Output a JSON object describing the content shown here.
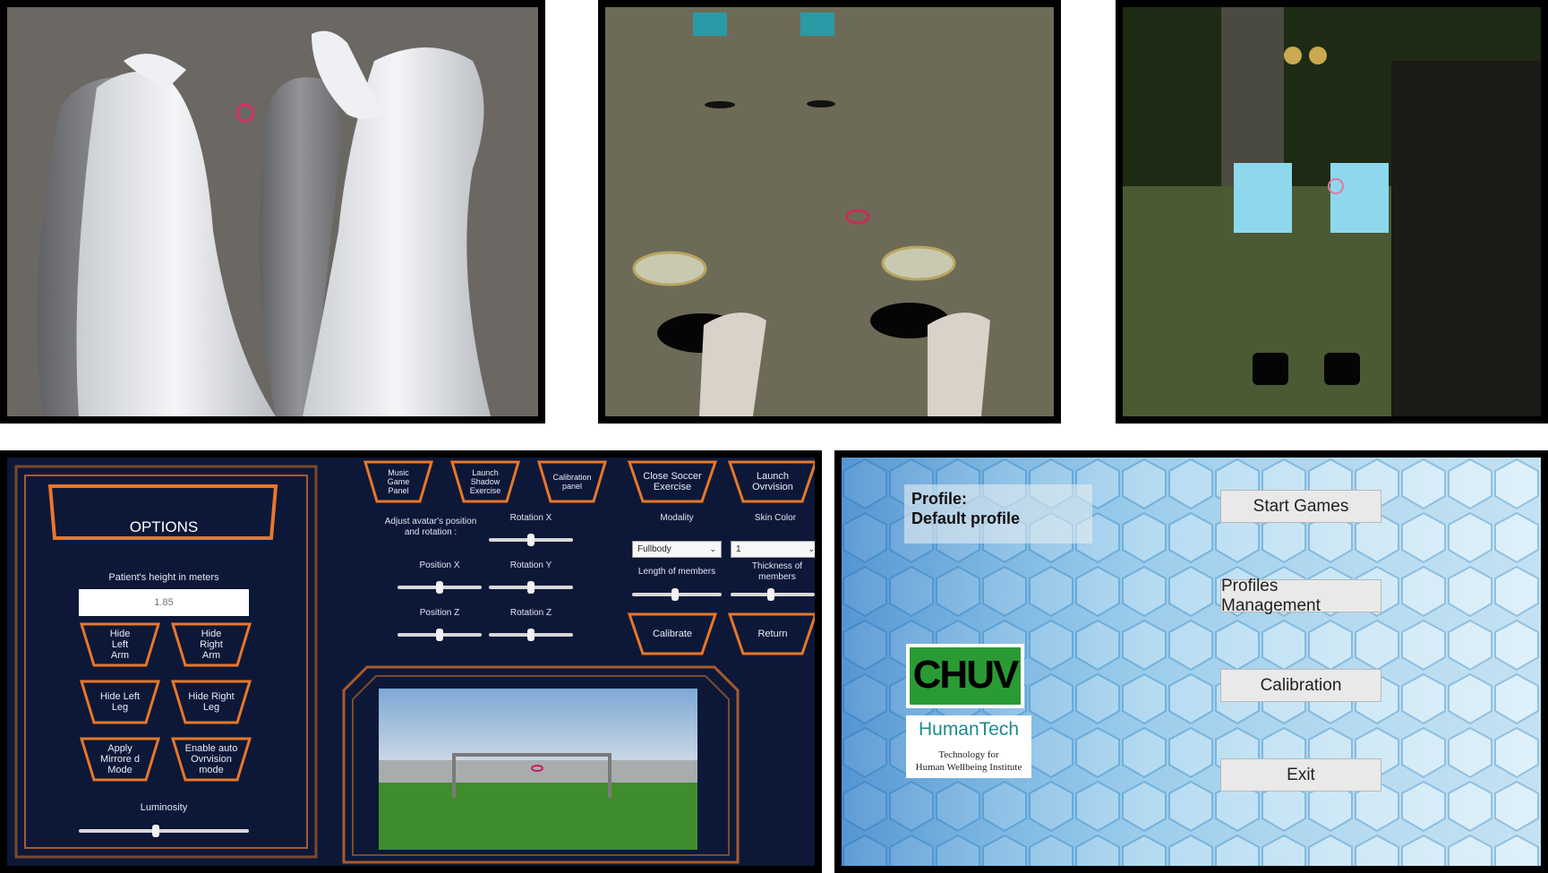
{
  "options_panel": {
    "title": "OPTIONS",
    "height_label": "Patient's height in meters",
    "height_placeholder": "1.85",
    "buttons": {
      "hide_left_arm": "Hide Left Arm",
      "hide_right_arm": "Hide Right Arm",
      "hide_left_leg": "Hide Left Leg",
      "hide_right_leg": "Hide Right Leg",
      "apply_mirrored": "Apply Mirrore d Mode",
      "enable_ovrvision": "Enable auto Ovrvision mode",
      "music_game": "Music Game Panel",
      "shadow_exercise": "Launch Shadow Exercise",
      "calibration_panel": "Calibration panel",
      "close_soccer": "Close Soccer Exercise",
      "launch_ovrvision": "Launch Ovrvision",
      "calibrate": "Calibrate",
      "return": "Return"
    },
    "luminosity_label": "Luminosity",
    "luminosity_value": 0.45,
    "adjust_label": "Adjust avatar's position and rotation :",
    "sliders": {
      "rotation_x": {
        "label": "Rotation X",
        "value": 0.5
      },
      "position_x": {
        "label": "Position X",
        "value": 0.5
      },
      "rotation_y": {
        "label": "Rotation Y",
        "value": 0.5
      },
      "position_z": {
        "label": "Position Z",
        "value": 0.5
      },
      "rotation_z": {
        "label": "Rotation Z",
        "value": 0.5
      },
      "length_members": {
        "label": "Length of members",
        "value": 0.48
      },
      "thickness_members": {
        "label": "Thickness of members",
        "value": 0.48
      }
    },
    "modality": {
      "label": "Modality",
      "selected": "Fullbody"
    },
    "skin_color": {
      "label": "Skin Color",
      "selected": "1"
    }
  },
  "main_menu": {
    "profile_title": "Profile:",
    "profile_name": "Default profile",
    "buttons": {
      "start_games": "Start Games",
      "profiles_management": "Profiles Management",
      "calibration": "Calibration",
      "exit": "Exit"
    },
    "logos": {
      "chuv": "CHUV",
      "humantech": "HumanTech",
      "humantech_tagline_1": "Technology for",
      "humantech_tagline_2": "Human Wellbeing Institute"
    }
  },
  "colors": {
    "panel_bg": "#0d1838",
    "orange_accent": "#e8772a",
    "tile_blue": "#5fc3e6",
    "menu_button_bg": "#e9e9e9"
  }
}
